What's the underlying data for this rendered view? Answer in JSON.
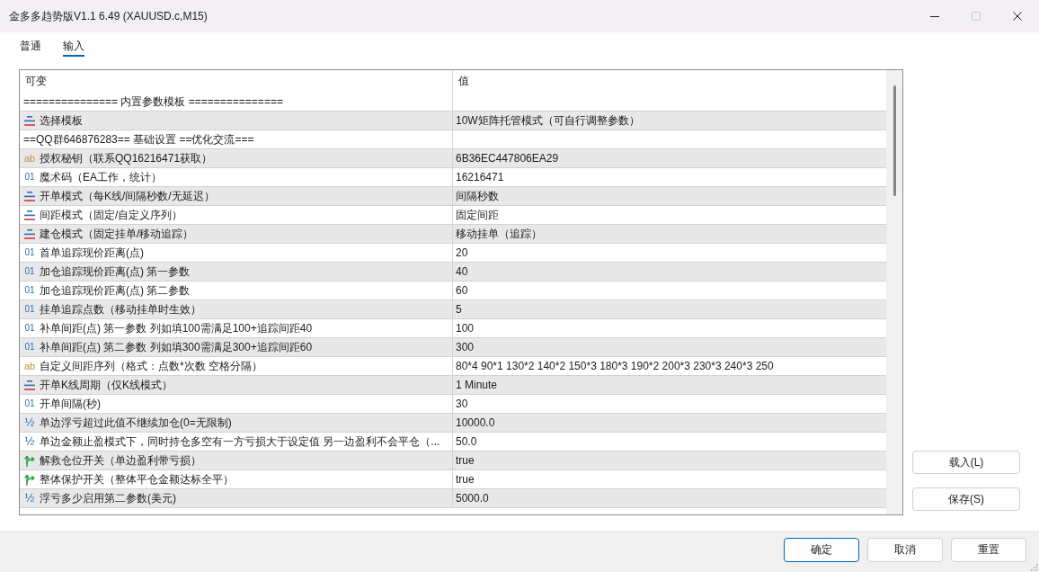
{
  "window": {
    "title": "金多多趋势版V1.1 6.49 (XAUUSD.c,M15)",
    "maximize_disabled": true
  },
  "tabs": [
    {
      "label": "普通",
      "selected": false
    },
    {
      "label": "输入",
      "selected": true
    }
  ],
  "inputs_table": {
    "columns": [
      "可变",
      "值"
    ],
    "rows": [
      {
        "kind": "separator",
        "name": "=============== 内置参数模板 ==============="
      },
      {
        "kind": "enum",
        "name": "选择模板",
        "value": "10W矩阵托管模式（可自行调整参数）"
      },
      {
        "kind": "separator",
        "name": "==QQ群646876283== 基础设置 ==优化交流==="
      },
      {
        "kind": "string",
        "glyph": "ab",
        "name": "授权秘钥（联系QQ16216471获取）",
        "value": "6B36EC447806EA29"
      },
      {
        "kind": "int",
        "glyph": "01",
        "name": "魔术码（EA工作，统计）",
        "value": "16216471"
      },
      {
        "kind": "enum",
        "name": "开单模式（每K线/间隔秒数/无延迟）",
        "value": "间隔秒数"
      },
      {
        "kind": "enum",
        "name": "间距模式（固定/自定义序列）",
        "value": "固定间距"
      },
      {
        "kind": "enum",
        "name": "建仓模式（固定挂单/移动追踪）",
        "value": "移动挂单（追踪）"
      },
      {
        "kind": "int",
        "glyph": "01",
        "name": "首单追踪现价距离(点)",
        "value": "20"
      },
      {
        "kind": "int",
        "glyph": "01",
        "name": "加仓追踪现价距离(点) 第一参数",
        "value": "40"
      },
      {
        "kind": "int",
        "glyph": "01",
        "name": "加仓追踪现价距离(点) 第二参数",
        "value": "60"
      },
      {
        "kind": "int",
        "glyph": "01",
        "name": "挂单追踪点数（移动挂单时生效）",
        "value": "5"
      },
      {
        "kind": "int",
        "glyph": "01",
        "name": "补单间距(点) 第一参数 列如填100需满足100+追踪间距40",
        "value": "100"
      },
      {
        "kind": "int",
        "glyph": "01",
        "name": "补单间距(点) 第二参数 列如填300需满足300+追踪间距60",
        "value": "300"
      },
      {
        "kind": "string",
        "glyph": "ab",
        "name": "自定义间距序列（格式：点数*次数 空格分隔）",
        "value": "80*4 90*1 130*2 140*2 150*3 180*3 190*2 200*3 230*3 240*3 250"
      },
      {
        "kind": "enum",
        "name": "开单K线周期（仅K线模式）",
        "value": "1 Minute"
      },
      {
        "kind": "int",
        "glyph": "01",
        "name": "开单间隔(秒)",
        "value": "30"
      },
      {
        "kind": "double",
        "glyph": "½",
        "name": "单边浮亏超过此值不继续加仓(0=无限制)",
        "value": "10000.0"
      },
      {
        "kind": "double",
        "glyph": "½",
        "name": "单边金额止盈模式下，同时持仓多空有一方亏损大于设定值 另一边盈利不会平仓（...",
        "value": "50.0"
      },
      {
        "kind": "bool",
        "name": "解救仓位开关（单边盈利带亏损）",
        "value": "true"
      },
      {
        "kind": "bool",
        "name": "整体保护开关（整体平仓金额达标全平）",
        "value": "true"
      },
      {
        "kind": "double",
        "glyph": "½",
        "name": "浮亏多少启用第二参数(美元)",
        "value": "5000.0"
      }
    ]
  },
  "side_buttons": [
    "载入(L)",
    "保存(S)"
  ],
  "footer_buttons": [
    {
      "label": "确定",
      "default": true
    },
    {
      "label": "取消",
      "default": false
    },
    {
      "label": "重置",
      "default": false
    }
  ]
}
